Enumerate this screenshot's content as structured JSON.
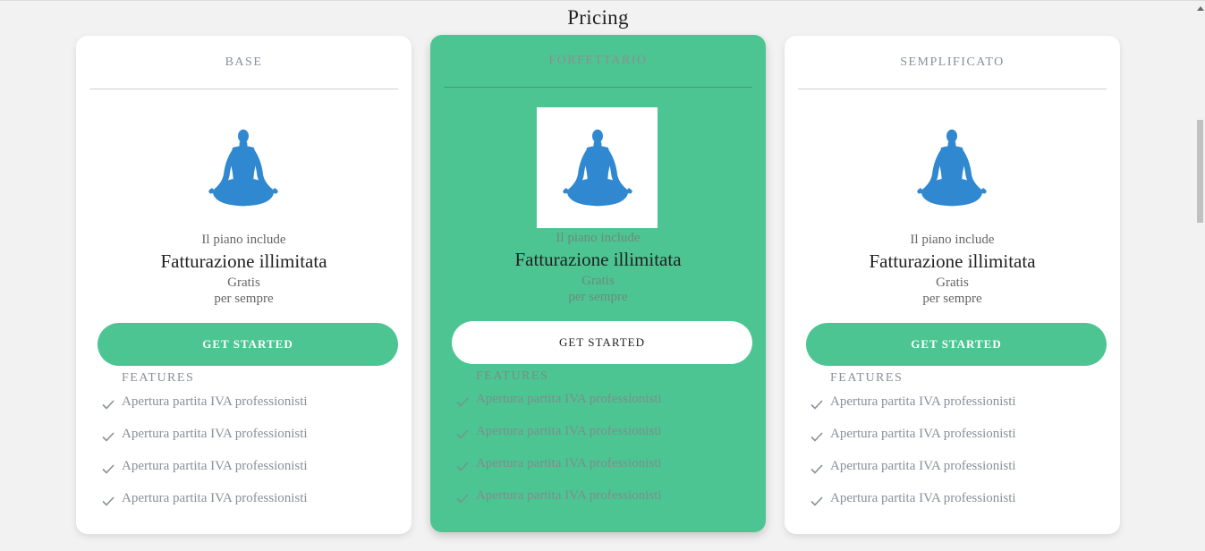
{
  "page": {
    "title": "Pricing"
  },
  "icons": {
    "illustration": "meditation-figure-icon",
    "check": "checkmark-icon"
  },
  "colors": {
    "accent": "#4dc592",
    "illustration": "#2f88d0"
  },
  "plans": [
    {
      "name": "BASE",
      "includes_label": "Il piano include",
      "feature": "Fatturazione illimitata",
      "price": "Gratis",
      "period": "per sempre",
      "cta": "GET STARTED",
      "features_heading": "FEATURES",
      "features": [
        "Apertura partita IVA professionisti",
        "Apertura partita IVA professionisti",
        "Apertura partita IVA professionisti",
        "Apertura partita IVA professionisti"
      ]
    },
    {
      "name": "FORFETTARIO",
      "includes_label": "Il piano include",
      "feature": "Fatturazione illimitata",
      "price": "Gratis",
      "period": "per sempre",
      "cta": "GET STARTED",
      "features_heading": "FEATURES",
      "features": [
        "Apertura partita IVA professionisti",
        "Apertura partita IVA professionisti",
        "Apertura partita IVA professionisti",
        "Apertura partita IVA professionisti"
      ]
    },
    {
      "name": "SEMPLIFICATO",
      "includes_label": "Il piano include",
      "feature": "Fatturazione illimitata",
      "price": "Gratis",
      "period": "per sempre",
      "cta": "GET STARTED",
      "features_heading": "FEATURES",
      "features": [
        "Apertura partita IVA professionisti",
        "Apertura partita IVA professionisti",
        "Apertura partita IVA professionisti",
        "Apertura partita IVA professionisti"
      ]
    }
  ]
}
